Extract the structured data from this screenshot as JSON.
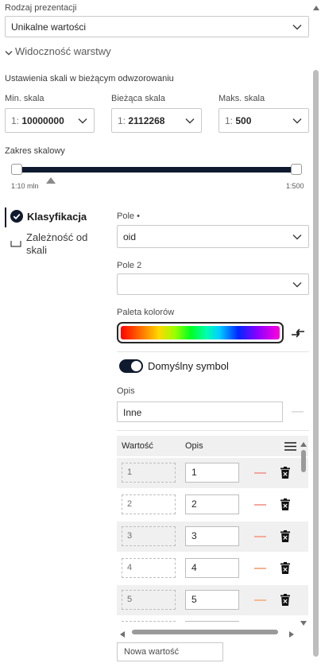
{
  "presentation": {
    "label": "Rodzaj prezentacji",
    "value": "Unikalne wartości"
  },
  "visibility": {
    "section_label": "Widoczność warstwy",
    "scale_settings_label": "Ustawienia skali w bieżącym odwzorowaniu",
    "min_label": "Min. skala",
    "current_label": "Bieżąca skala",
    "max_label": "Maks. skala",
    "scale_prefix": "1:",
    "min_value": "10000000",
    "current_value": "2112268",
    "max_value": "500",
    "range_label": "Zakres skalowy",
    "range_min_text": "1:10 mln",
    "range_max_text": "1:500"
  },
  "nav": {
    "items": [
      {
        "label": "Klasyfikacja",
        "active": true
      },
      {
        "label": "Zależność od skali",
        "active": false
      }
    ]
  },
  "classification": {
    "field_label": "Pole •",
    "field_value": "oid",
    "field2_label": "Pole 2",
    "field2_value": "",
    "palette_label": "Paleta kolorów",
    "default_symbol_label": "Domyślny symbol",
    "default_symbol_on": true,
    "desc_label": "Opis",
    "desc_value": "Inne"
  },
  "table": {
    "col_value": "Wartość",
    "col_desc": "Opis",
    "rows": [
      {
        "value": "1",
        "desc": "1",
        "color": "#f4a5a0"
      },
      {
        "value": "2",
        "desc": "2",
        "color": "#f4a79d"
      },
      {
        "value": "3",
        "desc": "3",
        "color": "#f5aa9a"
      },
      {
        "value": "4",
        "desc": "4",
        "color": "#f6b28e"
      },
      {
        "value": "5",
        "desc": "5",
        "color": "#f5b98d"
      }
    ],
    "new_value_placeholder": "Nowa wartość"
  },
  "colors": {
    "dark": "#0f1a2e",
    "accent_border": "#262626"
  }
}
